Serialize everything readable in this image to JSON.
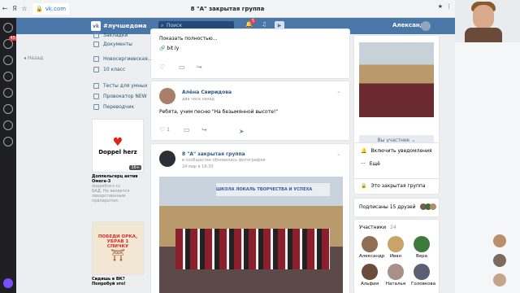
{
  "browser": {
    "back_icon": "back-arrow-icon",
    "url": "vk.com",
    "tab_title": "8 \"А\" закрытая группа",
    "ya_label": "Я"
  },
  "vk": {
    "logo_text": "#лучшедома",
    "search_placeholder": "Поиск",
    "bell_count": "5",
    "user_name": "Александр"
  },
  "left_nav": {
    "back_label": "Назад",
    "items": [
      {
        "label": "Закладки",
        "icon": "bookmark-icon"
      },
      {
        "label": "Документы",
        "icon": "document-icon"
      },
      {
        "label": "Новосергиевская...",
        "icon": "group-icon"
      },
      {
        "label": "10 класс",
        "icon": "group-icon"
      },
      {
        "label": "Тесты для умных",
        "icon": "group-icon"
      },
      {
        "label": "Провокатор NEW",
        "icon": "group-icon"
      },
      {
        "label": "Переводчик",
        "icon": "translate-icon"
      }
    ]
  },
  "ads": [
    {
      "brand": "Doppel herz",
      "age": "16+",
      "title": "Доппельгерц актив Омега-3",
      "domain": "doppelherz.ru",
      "desc": "БАД. Не является лекарственным препаратом."
    },
    {
      "image_text": "ПОБЕДИ ОРКА, УБРАВ 1 СПИЧКУ",
      "title": "Сидишь в ВК? Попробуй это!"
    }
  ],
  "posts": [
    {
      "snippet": "Показать полностью...",
      "link": "bit.ly"
    },
    {
      "author": "Алёна Свиридова",
      "time": "два часа назад",
      "text": "Ребята, учим песню \"На безымянной высоте!\"",
      "likes": "1"
    },
    {
      "author": "8 \"А\" закрытая группа",
      "subline": "в сообществе обновилась фотография",
      "date": "24 мар в 19:30",
      "photo_banner": "ШКОЛА ЛОКАЛЬ ТВОРЧЕСТВА И УСПЕХА"
    }
  ],
  "right": {
    "members_button": "Вы участник",
    "notify": "Включить уведомления",
    "more": "Ещё",
    "closed_group": "Это закрытая группа",
    "friends_sub": "Подписаны 15 друзей",
    "members_title": "Участники",
    "members_count": "24",
    "members": [
      {
        "name": "Александр",
        "color": "#8e6e55"
      },
      {
        "name": "Иван",
        "color": "#c9a36a"
      },
      {
        "name": "Вера",
        "color": "#3d7a3c"
      },
      {
        "name": "Альфия",
        "color": "#6b4c3b"
      },
      {
        "name": "Наталья",
        "color": "#a98f88"
      },
      {
        "name": "Головкова",
        "color": "#5b5f71"
      }
    ]
  },
  "colors": {
    "vk_blue": "#4a76a8",
    "link": "#2a5885",
    "page_bg": "#edeef0"
  }
}
